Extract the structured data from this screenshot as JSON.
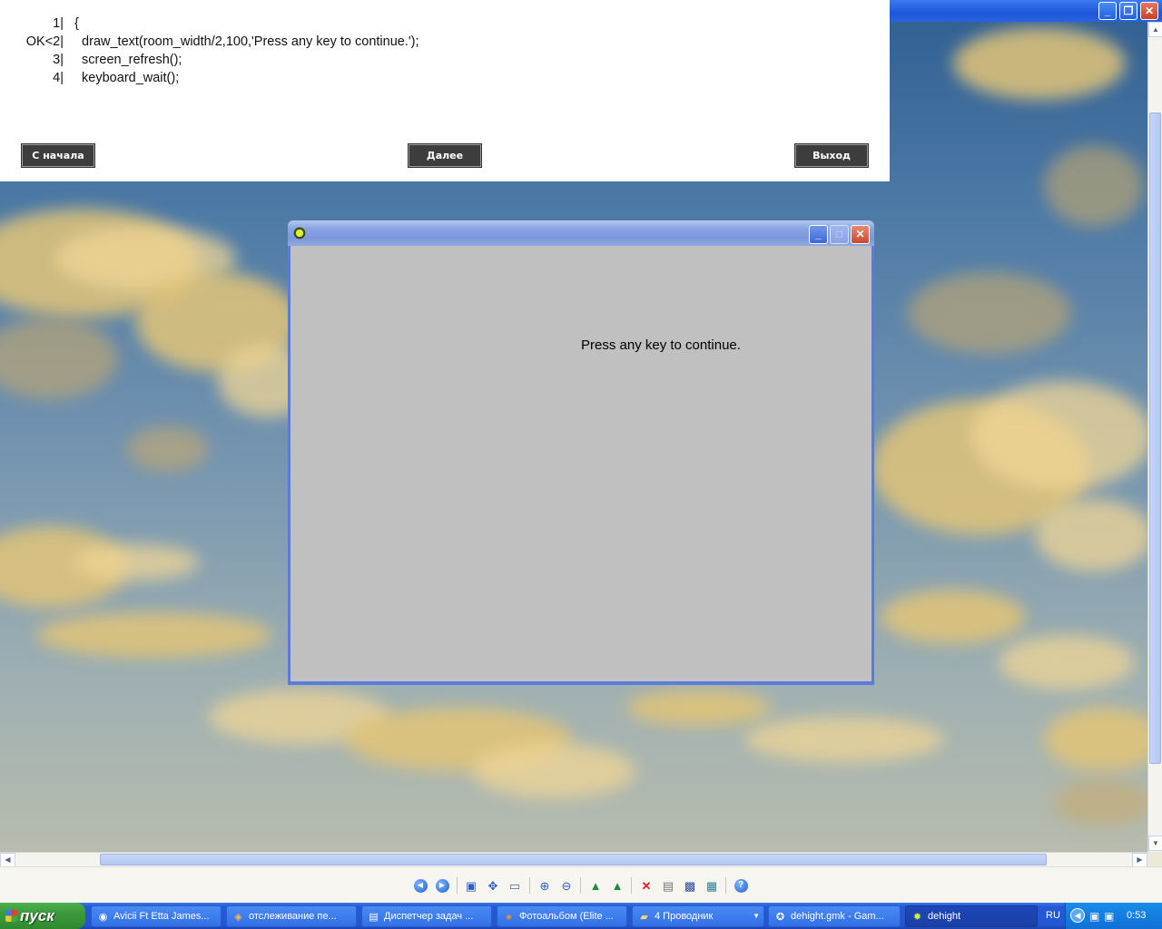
{
  "tutorial": {
    "code_lines": [
      {
        "num": "1|",
        "text": "{"
      },
      {
        "num": "OK<2|",
        "text": "  draw_text(room_width/2,100,'Press any key to continue.');"
      },
      {
        "num": "3|",
        "text": "  screen_refresh();"
      },
      {
        "num": "4|",
        "text": "  keyboard_wait();"
      }
    ],
    "buttons": {
      "restart": "С начала",
      "next": "Далее",
      "exit": "Выход"
    }
  },
  "game_window": {
    "message": "Press any key to continue.",
    "canvas_color": "#c0c0c0",
    "icon": "game-maker-gear-icon"
  },
  "viewer_toolbar": {
    "icons": [
      "previous-image-icon",
      "next-image-icon",
      "best-fit-icon",
      "actual-size-icon",
      "slideshow-icon",
      "zoom-in-icon",
      "zoom-out-icon",
      "rotate-clockwise-icon",
      "rotate-counterclockwise-icon",
      "delete-icon",
      "print-icon",
      "save-icon",
      "open-with-icon",
      "help-icon"
    ]
  },
  "taskbar": {
    "start_label": "пуск",
    "tasks": [
      {
        "label": "Avicii Ft Etta James...",
        "icon": "media-player-icon"
      },
      {
        "label": "отслеживание пе...",
        "icon": "browser-icon"
      },
      {
        "label": "Диспетчер задач ...",
        "icon": "task-manager-icon"
      },
      {
        "label": "Фотоальбом (Elite ...",
        "icon": "firefox-icon"
      },
      {
        "label": "4 Проводник",
        "icon": "folder-icon"
      },
      {
        "label": "dehight.gmk - Gam...",
        "icon": "game-maker-icon"
      },
      {
        "label": "dehight",
        "icon": "game-icon"
      }
    ],
    "language": "RU",
    "clock": "0:53"
  }
}
